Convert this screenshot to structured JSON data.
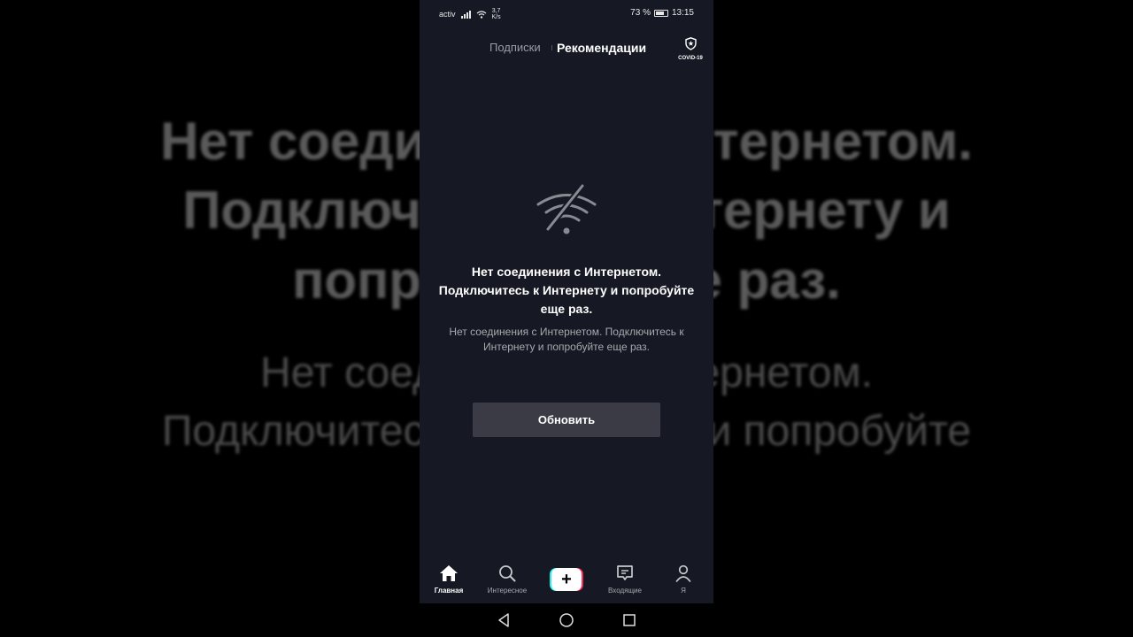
{
  "background": {
    "lines": [
      "Нет соединения с Интернетом.",
      "Подключитесь к Интернету и",
      "попробуйте еще раз.",
      "Нет соединения с Интернетом.",
      "Подключитесь к Интернету и попробуйте"
    ]
  },
  "statusbar": {
    "carrier": "activ",
    "speed_value": "3,7",
    "speed_unit": "K/s",
    "battery": "73 %",
    "battery_level": 0.73,
    "time": "13:15"
  },
  "topnav": {
    "tab_following": "Подписки",
    "tab_foryou": "Рекомендации",
    "covid_label": "COVID-19"
  },
  "error": {
    "title": "Нет соединения с Интернетом. Подключитесь к Интернету и попробуйте еще раз.",
    "subtitle": "Нет соединения с Интернетом. Подключитесь к Интернету и попробуйте еще раз.",
    "refresh_label": "Обновить",
    "icon": "wifi-off-icon"
  },
  "bottomnav": {
    "home": "Главная",
    "discover": "Интересное",
    "inbox": "Входящие",
    "me": "Я"
  },
  "colors": {
    "screen_bg": "#161823",
    "button_bg": "#3a3b44",
    "accent_cyan": "#25f4ee",
    "accent_red": "#fe2c55"
  }
}
